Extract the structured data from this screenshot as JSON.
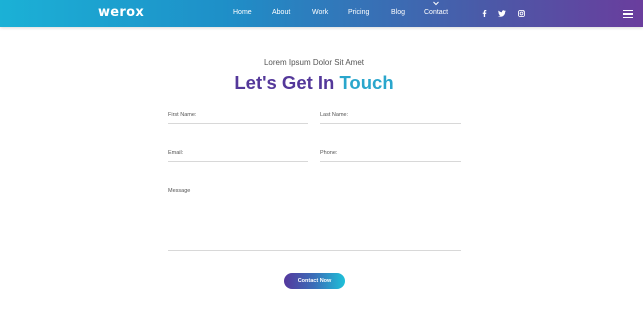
{
  "brand": {
    "logo_text": "werox"
  },
  "nav": {
    "items": [
      {
        "label": "Home"
      },
      {
        "label": "About"
      },
      {
        "label": "Work"
      },
      {
        "label": "Pricing"
      },
      {
        "label": "Blog"
      },
      {
        "label": "Contact"
      }
    ],
    "active_indicator_icon": "chevron-down-icon",
    "social_icons": [
      "facebook-icon",
      "twitter-icon",
      "instagram-icon"
    ],
    "menu_icon": "hamburger-menu-icon"
  },
  "colors": {
    "nav_gradient_start": "#1bb1d6",
    "nav_gradient_end": "#6a3d9d",
    "title_purple": "#54389a",
    "title_blue": "#2aa6cc"
  },
  "section": {
    "subtitle": "Lorem Ipsum Dolor Sit Amet",
    "title_part_a": "Let's Get In",
    "title_part_b": "Touch"
  },
  "form": {
    "first_name_label": "First Name:",
    "last_name_label": "Last Name:",
    "email_label": "Email:",
    "phone_label": "Phone:",
    "message_label": "Message",
    "submit_label": "Contact Now"
  }
}
